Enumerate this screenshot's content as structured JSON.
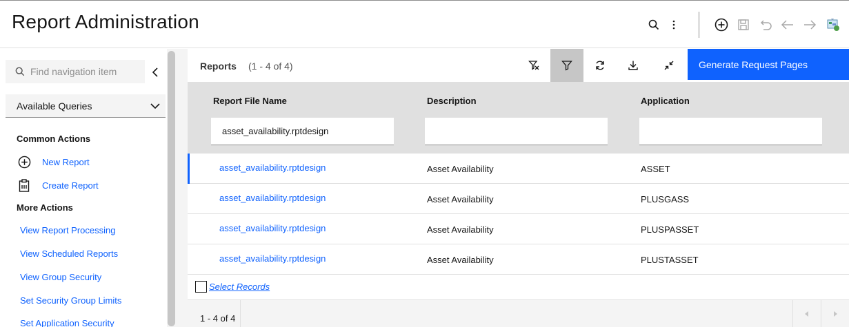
{
  "header": {
    "title": "Report Administration",
    "icons": [
      "search-icon",
      "overflow-menu-icon",
      "add-icon",
      "save-icon",
      "undo-icon",
      "back-arrow-icon",
      "forward-arrow-icon",
      "app-logo-icon"
    ]
  },
  "sidebar": {
    "search_placeholder": "Find navigation item",
    "queries_label": "Available Queries",
    "common_actions_title": "Common Actions",
    "common_actions": [
      {
        "label": "New Report",
        "icon": "add-circle-icon"
      },
      {
        "label": "Create Report",
        "icon": "clipboard-icon"
      }
    ],
    "more_actions_title": "More Actions",
    "more_actions": [
      "View Report Processing",
      "View Scheduled Reports",
      "View Group Security",
      "Set Security Group Limits",
      "Set Application Security"
    ]
  },
  "table": {
    "title": "Reports",
    "count": "(1 - 4 of 4)",
    "primary_action": "Generate Request Pages",
    "toolbar_icons": [
      "clear-filter-icon",
      "filter-icon",
      "refresh-icon",
      "download-icon",
      "collapse-icon"
    ],
    "columns": [
      "Report File Name",
      "Description",
      "Application"
    ],
    "filters": [
      "asset_availability.rptdesign",
      "",
      ""
    ],
    "rows": [
      {
        "file": "asset_availability.rptdesign",
        "description": "Asset Availability",
        "application": "ASSET"
      },
      {
        "file": "asset_availability.rptdesign",
        "description": "Asset Availability",
        "application": "PLUSGASS"
      },
      {
        "file": "asset_availability.rptdesign",
        "description": "Asset Availability",
        "application": "PLUSPASSET"
      },
      {
        "file": "asset_availability.rptdesign",
        "description": "Asset Availability",
        "application": "PLUSTASSET"
      }
    ],
    "select_records": "Select Records",
    "footer_count": "1 - 4 of 4"
  },
  "colors": {
    "accent": "#0f62fe",
    "header_bg": "#e0e0e0",
    "active_button": "#c6c6c6"
  }
}
